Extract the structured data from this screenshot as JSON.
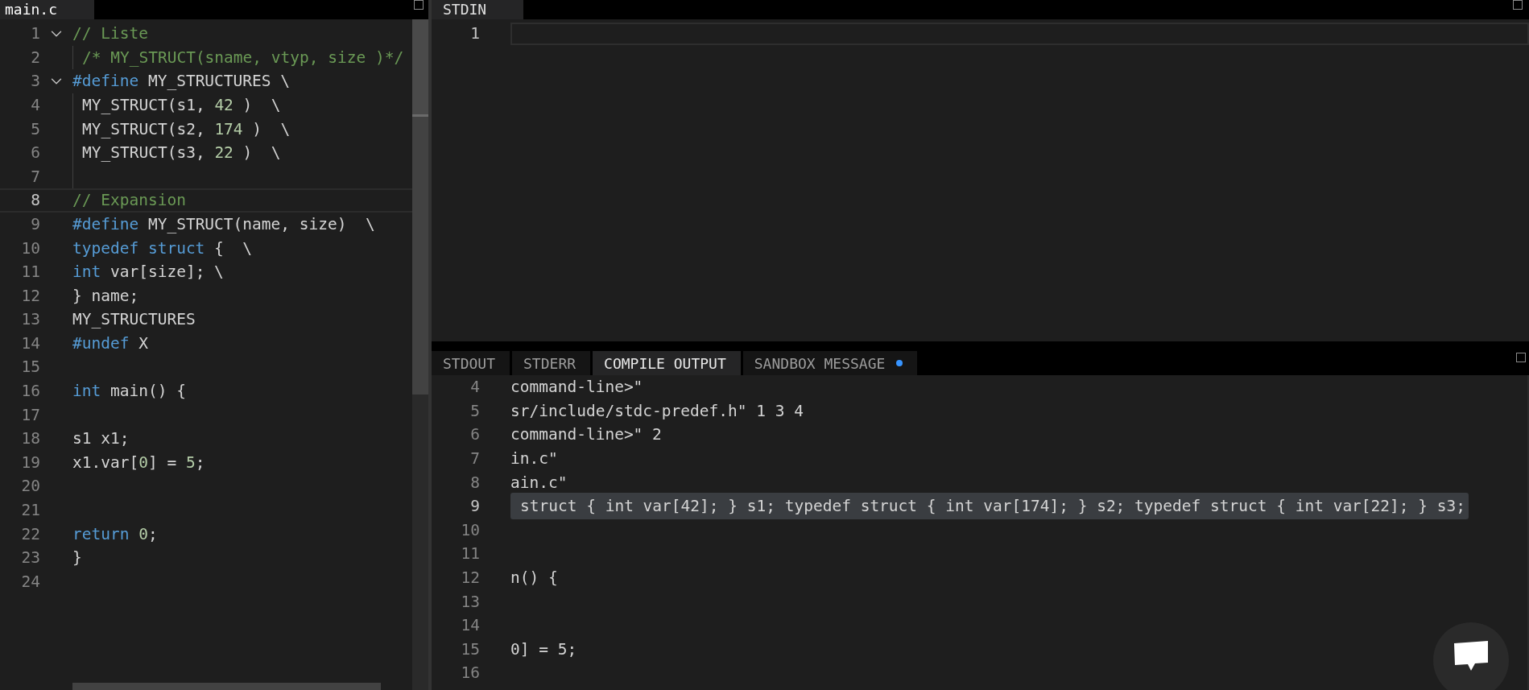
{
  "editor": {
    "tab": "main.c",
    "lines": [
      {
        "number": "1",
        "fold": true,
        "guide": false,
        "current": false,
        "tokens": [
          {
            "kind": "comment",
            "text": "// Liste"
          }
        ]
      },
      {
        "number": "2",
        "fold": false,
        "guide": true,
        "current": false,
        "tokens": [
          {
            "kind": "comment",
            "text": "/* MY_STRUCT(sname, vtyp, size )*/"
          }
        ]
      },
      {
        "number": "3",
        "fold": true,
        "guide": false,
        "current": false,
        "tokens": [
          {
            "kind": "keyword",
            "text": "#define"
          },
          {
            "kind": "plain",
            "text": " MY_STRUCTURES \\"
          }
        ]
      },
      {
        "number": "4",
        "fold": false,
        "guide": true,
        "current": false,
        "tokens": [
          {
            "kind": "plain",
            "text": "MY_STRUCT(s1, "
          },
          {
            "kind": "number",
            "text": "42"
          },
          {
            "kind": "plain",
            "text": " )  \\"
          }
        ]
      },
      {
        "number": "5",
        "fold": false,
        "guide": true,
        "current": false,
        "tokens": [
          {
            "kind": "plain",
            "text": "MY_STRUCT(s2, "
          },
          {
            "kind": "number",
            "text": "174"
          },
          {
            "kind": "plain",
            "text": " )  \\"
          }
        ]
      },
      {
        "number": "6",
        "fold": false,
        "guide": true,
        "current": false,
        "tokens": [
          {
            "kind": "plain",
            "text": "MY_STRUCT(s3, "
          },
          {
            "kind": "number",
            "text": "22"
          },
          {
            "kind": "plain",
            "text": " )  \\"
          }
        ]
      },
      {
        "number": "7",
        "fold": false,
        "guide": true,
        "current": false
      },
      {
        "number": "8",
        "fold": false,
        "guide": false,
        "current": true,
        "tokens": [
          {
            "kind": "comment",
            "text": "// Expansion"
          }
        ]
      },
      {
        "number": "9",
        "fold": false,
        "guide": false,
        "current": false,
        "tokens": [
          {
            "kind": "keyword",
            "text": "#define"
          },
          {
            "kind": "plain",
            "text": " MY_STRUCT(name, size)  \\"
          }
        ]
      },
      {
        "number": "10",
        "fold": false,
        "guide": false,
        "current": false,
        "tokens": [
          {
            "kind": "keyword",
            "text": "typedef struct"
          },
          {
            "kind": "plain",
            "text": " {  \\"
          }
        ]
      },
      {
        "number": "11",
        "fold": false,
        "guide": false,
        "current": false,
        "tokens": [
          {
            "kind": "keyword",
            "text": "int"
          },
          {
            "kind": "plain",
            "text": " var[size]; \\"
          }
        ]
      },
      {
        "number": "12",
        "fold": false,
        "guide": false,
        "current": false,
        "tokens": [
          {
            "kind": "plain",
            "text": "} name;"
          }
        ]
      },
      {
        "number": "13",
        "fold": false,
        "guide": false,
        "current": false,
        "tokens": [
          {
            "kind": "plain",
            "text": "MY_STRUCTURES"
          }
        ]
      },
      {
        "number": "14",
        "fold": false,
        "guide": false,
        "current": false,
        "tokens": [
          {
            "kind": "keyword",
            "text": "#undef"
          },
          {
            "kind": "plain",
            "text": " X"
          }
        ]
      },
      {
        "number": "15",
        "fold": false,
        "guide": false,
        "current": false
      },
      {
        "number": "16",
        "fold": false,
        "guide": false,
        "current": false,
        "tokens": [
          {
            "kind": "keyword",
            "text": "int"
          },
          {
            "kind": "plain",
            "text": " main() {"
          }
        ]
      },
      {
        "number": "17",
        "fold": false,
        "guide": false,
        "current": false
      },
      {
        "number": "18",
        "fold": false,
        "guide": false,
        "current": false,
        "tokens": [
          {
            "kind": "plain",
            "text": "s1 x1;"
          }
        ]
      },
      {
        "number": "19",
        "fold": false,
        "guide": false,
        "current": false,
        "tokens": [
          {
            "kind": "plain",
            "text": "x1.var["
          },
          {
            "kind": "number",
            "text": "0"
          },
          {
            "kind": "plain",
            "text": "] = "
          },
          {
            "kind": "number",
            "text": "5"
          },
          {
            "kind": "plain",
            "text": ";"
          }
        ]
      },
      {
        "number": "20",
        "fold": false,
        "guide": false,
        "current": false
      },
      {
        "number": "21",
        "fold": false,
        "guide": false,
        "current": false
      },
      {
        "number": "22",
        "fold": false,
        "guide": false,
        "current": false,
        "tokens": [
          {
            "kind": "keyword",
            "text": "return "
          },
          {
            "kind": "number",
            "text": "0"
          },
          {
            "kind": "plain",
            "text": ";"
          }
        ]
      },
      {
        "number": "23",
        "fold": false,
        "guide": false,
        "current": false,
        "tokens": [
          {
            "kind": "plain",
            "text": "}"
          }
        ]
      },
      {
        "number": "24",
        "fold": false,
        "guide": false,
        "current": false
      }
    ]
  },
  "stdin": {
    "tab": "STDIN",
    "lines": [
      {
        "number": "1",
        "current": true
      }
    ]
  },
  "output": {
    "tabs": [
      {
        "label": "STDOUT",
        "selected": false,
        "modified": false
      },
      {
        "label": "STDERR",
        "selected": false,
        "modified": false
      },
      {
        "label": "COMPILE OUTPUT",
        "selected": true,
        "modified": false
      },
      {
        "label": "SANDBOX MESSAGE",
        "selected": false,
        "modified": true
      }
    ],
    "lines": [
      {
        "number": "4",
        "text": "command-line>\"",
        "selected": false
      },
      {
        "number": "5",
        "text": "sr/include/stdc-predef.h\" 1 3 4",
        "selected": false
      },
      {
        "number": "6",
        "text": "command-line>\" 2",
        "selected": false
      },
      {
        "number": "7",
        "text": "in.c\"",
        "selected": false
      },
      {
        "number": "8",
        "text": "ain.c\"",
        "selected": false
      },
      {
        "number": "9",
        "text": "struct { int var[42]; } s1; typedef struct { int var[174]; } s2; typedef struct { int var[22]; } s3;",
        "selected": true
      },
      {
        "number": "10",
        "selected": false
      },
      {
        "number": "11",
        "selected": false
      },
      {
        "number": "12",
        "text": "n() {",
        "selected": false
      },
      {
        "number": "13",
        "selected": false
      },
      {
        "number": "14",
        "selected": false
      },
      {
        "number": "15",
        "text": "0] = 5;",
        "selected": false
      },
      {
        "number": "16",
        "selected": false
      }
    ]
  }
}
